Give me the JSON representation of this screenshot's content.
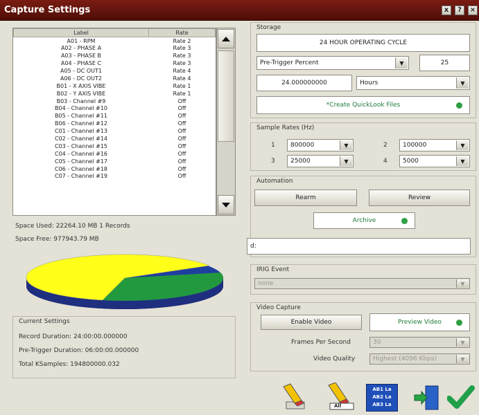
{
  "window": {
    "title": "Capture Settings",
    "btn_min": "x",
    "btn_help": "?",
    "btn_close": "×"
  },
  "table": {
    "col_label": "Label",
    "col_rate": "Rate",
    "rows": [
      {
        "label": "A01 - RPM",
        "rate": "Rate 2"
      },
      {
        "label": "A02 - PHASE A",
        "rate": "Rate 3"
      },
      {
        "label": "A03 - PHASE B",
        "rate": "Rate 3"
      },
      {
        "label": "A04 - PHASE C",
        "rate": "Rate 3"
      },
      {
        "label": "A05 - DC OUT1",
        "rate": "Rate 4"
      },
      {
        "label": "A06 - DC OUT2",
        "rate": "Rate 4"
      },
      {
        "label": "B01 - X AXIS VIBE",
        "rate": "Rate 1"
      },
      {
        "label": "B02 - Y AXIS VIBE",
        "rate": "Rate 1"
      },
      {
        "label": "B03 - Channel #9",
        "rate": "Off"
      },
      {
        "label": "B04 - Channel #10",
        "rate": "Off"
      },
      {
        "label": "B05 - Channel #11",
        "rate": "Off"
      },
      {
        "label": "B06 - Channel #12",
        "rate": "Off"
      },
      {
        "label": "C01 - Channel #13",
        "rate": "Off"
      },
      {
        "label": "C02 - Channel #14",
        "rate": "Off"
      },
      {
        "label": "C03 - Channel #15",
        "rate": "Off"
      },
      {
        "label": "C04 - Channel #16",
        "rate": "Off"
      },
      {
        "label": "C05 - Channel #17",
        "rate": "Off"
      },
      {
        "label": "C06 - Channel #18",
        "rate": "Off"
      },
      {
        "label": "C07 - Channel #19",
        "rate": "Off"
      }
    ]
  },
  "space": {
    "used": "Space Used: 22264.10 MB  1 Records",
    "free": "Space Free: 977943.79 MB"
  },
  "pie": {
    "colors": {
      "used": "#23993f",
      "free": "#ffff1a",
      "other": "#1f3f9f",
      "edge": "#1a2a6a"
    }
  },
  "current": {
    "title": "Current Settings",
    "record": "Record Duration: 24:00:00.000000",
    "pretrigger": "Pre-Trigger Duration: 06:00:00.000000",
    "ksamples": "Total KSamples: 194800000.032"
  },
  "storage": {
    "title": "Storage",
    "mode": "24 HOUR OPERATING CYCLE",
    "pretrigger_select": "Pre-Trigger Percent",
    "pretrigger_value": "25",
    "duration_value": "24.000000000",
    "duration_unit": "Hours",
    "quicklook": "*Create QuickLook Files"
  },
  "rates": {
    "title": "Sample Rates (Hz)",
    "items": [
      {
        "n": "1",
        "v": "800000"
      },
      {
        "n": "2",
        "v": "100000"
      },
      {
        "n": "3",
        "v": "25000"
      },
      {
        "n": "4",
        "v": "5000"
      }
    ]
  },
  "automation": {
    "title": "Automation",
    "rearm": "Rearm",
    "review": "Review",
    "archive": "Archive",
    "path": "d:"
  },
  "irig": {
    "title": "IRIG Event",
    "value": "none"
  },
  "video": {
    "title": "Video Capture",
    "enable": "Enable Video",
    "preview": "Preview Video",
    "fps_label": "Frames Per Second",
    "fps_value": "30",
    "quality_label": "Video Quality",
    "quality_value": "Highest (4096 Kbps)"
  },
  "toolbar": {
    "all_label": "All",
    "ab_line1": "AB1 La",
    "ab_line2": "AB2 La",
    "ab_line3": "AB3 La"
  }
}
